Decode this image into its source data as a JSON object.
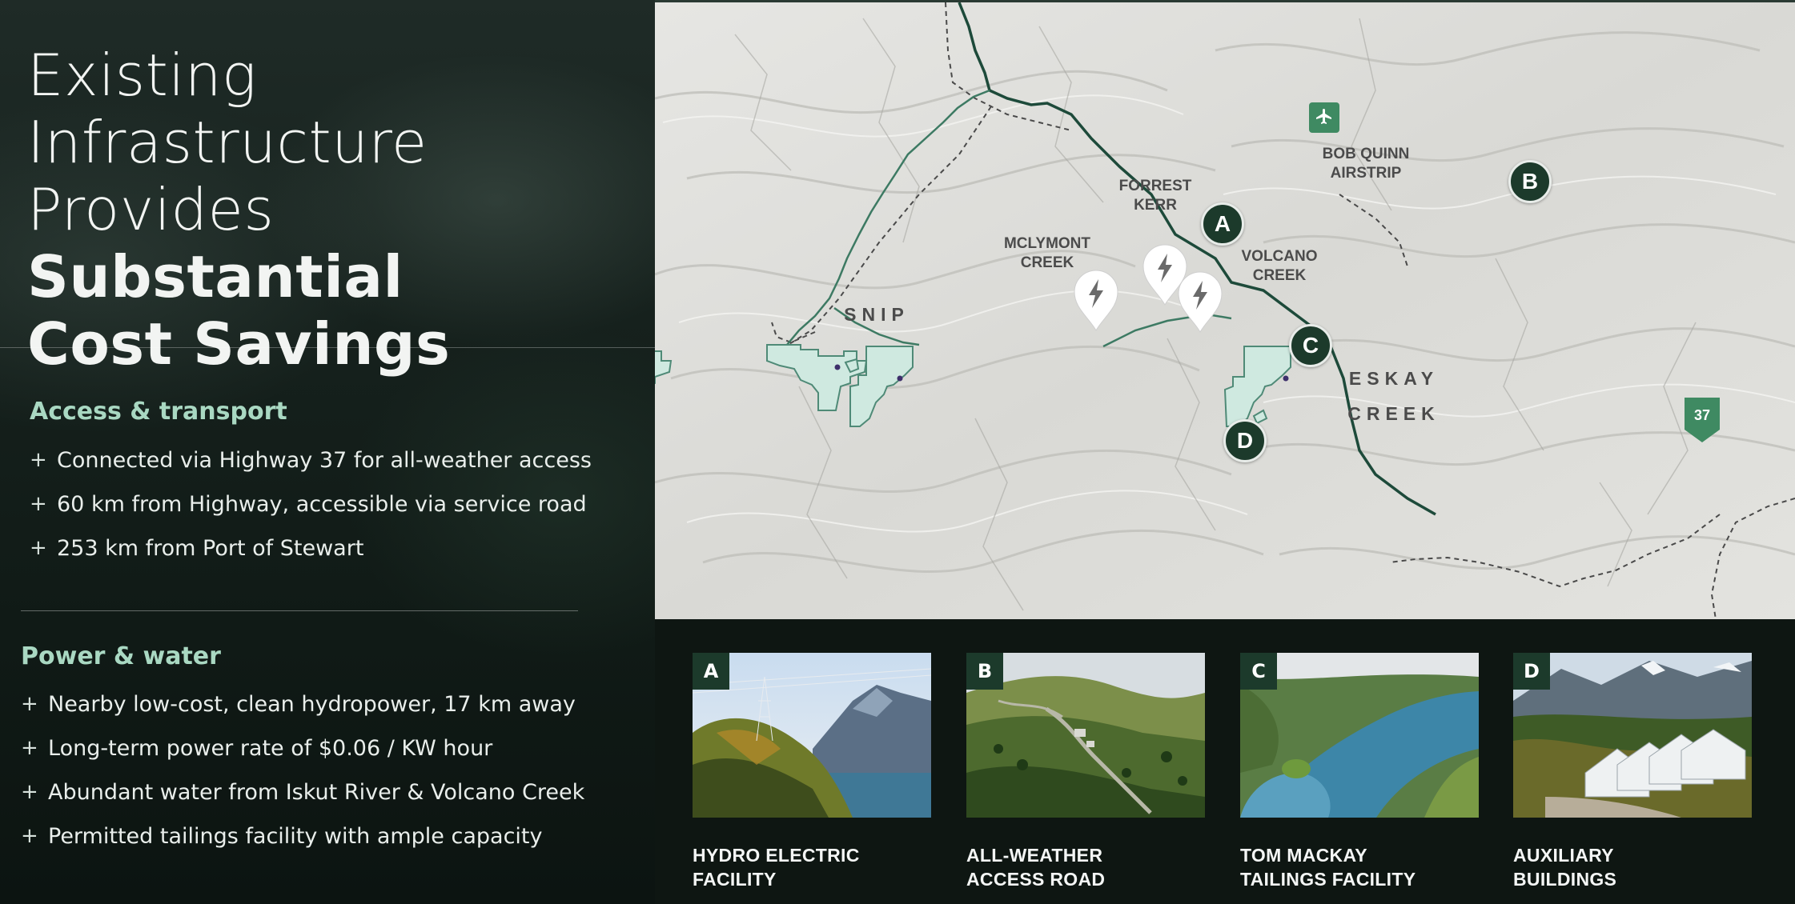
{
  "title": {
    "line1": "Existing",
    "line2": "Infrastructure",
    "line3_light": "Provides ",
    "line3_bold": "Substantial",
    "line4": "Cost Savings"
  },
  "access": {
    "heading": "Access & transport",
    "items": [
      "Connected via Highway 37 for all-weather access",
      "60 km from Highway, accessible via service road",
      "253 km from Port of Stewart"
    ]
  },
  "power": {
    "heading": "Power & water",
    "items": [
      "Nearby low-cost, clean hydropower, 17 km away",
      "Long-term power rate of $0.06 / KW hour",
      "Abundant water from Iskut River & Volcano Creek",
      "Permitted tailings facility with ample capacity"
    ]
  },
  "bullet_symbol": "+",
  "map": {
    "labels": {
      "forrest_kerr": "FORREST\nKERR",
      "bob_quinn": "BOB QUINN\nAIRSTRIP",
      "mclymont": "MCLYMONT\nCREEK",
      "volcano": "VOLCANO\nCREEK",
      "snip": "SNIP",
      "eskay": "ESKAY\nCREEK"
    },
    "markers": {
      "a": "A",
      "b": "B",
      "c": "C",
      "d": "D"
    },
    "highway_shield": "37",
    "icons": [
      "airport-icon",
      "bolt-icon"
    ]
  },
  "cards": [
    {
      "letter": "A",
      "caption": "HYDRO ELECTRIC\nFACILITY"
    },
    {
      "letter": "B",
      "caption": "ALL-WEATHER\nACCESS ROAD"
    },
    {
      "letter": "C",
      "caption": "TOM MACKAY\nTAILINGS FACILITY"
    },
    {
      "letter": "D",
      "caption": "AUXILIARY\nBUILDINGS"
    }
  ],
  "colors": {
    "accent_green": "#a9d8c2",
    "marker_dark": "#1c3a2b",
    "road": "#1d4a3a",
    "claim_fill": "#cfe9e0",
    "airport": "#3f8a62"
  }
}
